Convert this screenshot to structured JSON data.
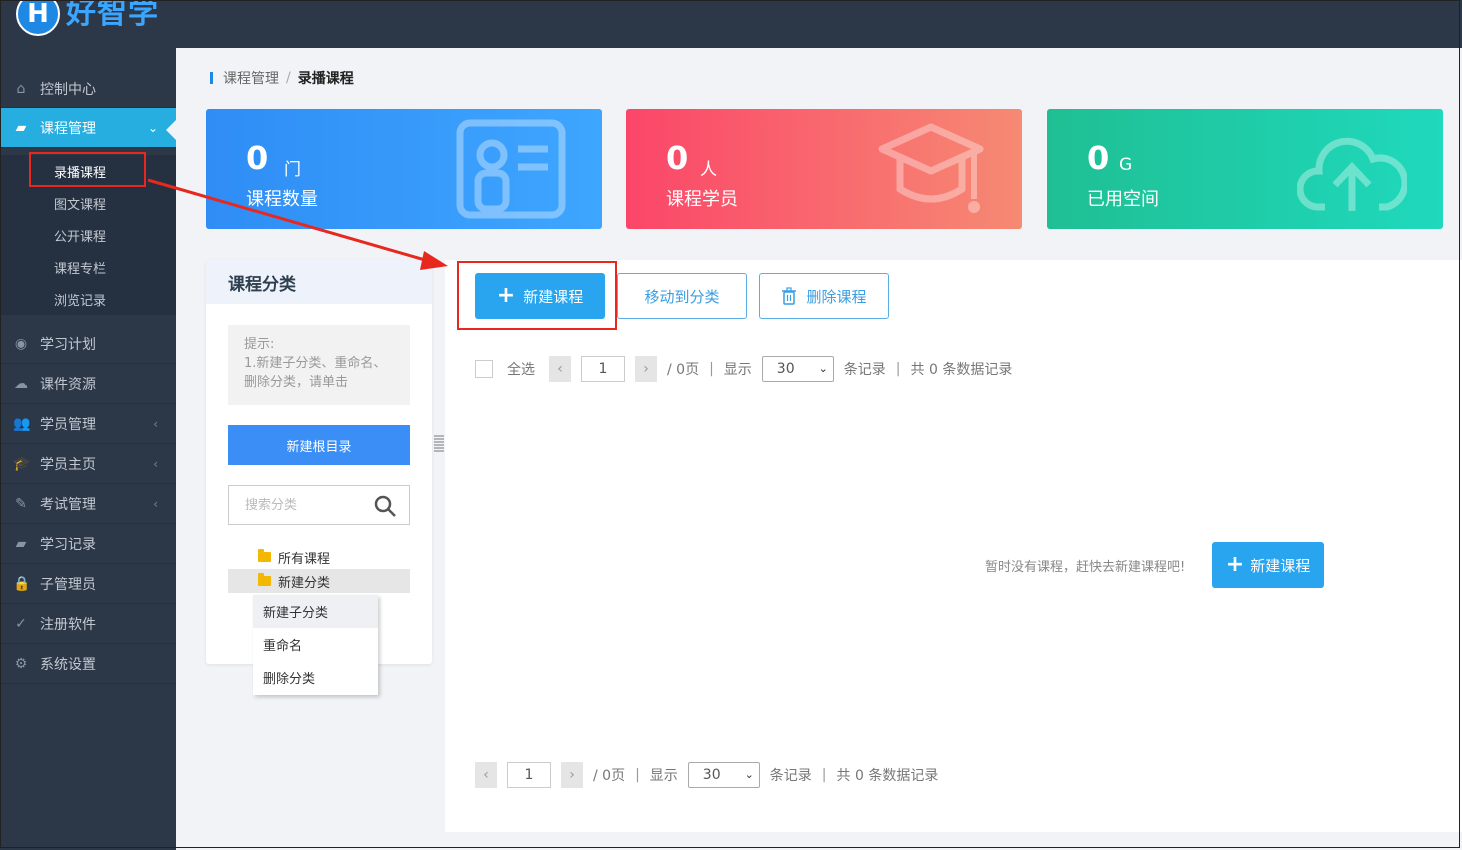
{
  "app": {
    "logo_letter": "H",
    "name": "好智学"
  },
  "sidebar": {
    "items": [
      {
        "label": "控制中心",
        "icon": "home-icon"
      },
      {
        "label": "课程管理",
        "icon": "book-icon",
        "active": true
      },
      {
        "label": "学习计划",
        "icon": "eye-icon"
      },
      {
        "label": "课件资源",
        "icon": "cloud-upload-icon"
      },
      {
        "label": "学员管理",
        "icon": "users-icon"
      },
      {
        "label": "学员主页",
        "icon": "graduation-cap-icon"
      },
      {
        "label": "考试管理",
        "icon": "pen-icon"
      },
      {
        "label": "学习记录",
        "icon": "book-icon"
      },
      {
        "label": "子管理员",
        "icon": "lock-icon"
      },
      {
        "label": "注册软件",
        "icon": "check-circle-icon"
      },
      {
        "label": "系统设置",
        "icon": "gear-icon"
      }
    ],
    "sub_items": [
      "录播课程",
      "图文课程",
      "公开课程",
      "课程专栏",
      "浏览记录"
    ]
  },
  "breadcrumb": {
    "parent": "课程管理",
    "sep": "/",
    "current": "录播课程"
  },
  "stats": [
    {
      "value": "0",
      "unit": "门",
      "label": "课程数量",
      "icon": "id-card-icon"
    },
    {
      "value": "0",
      "unit": "人",
      "label": "课程学员",
      "icon": "graduation-cap-icon"
    },
    {
      "value": "0",
      "unit": "G",
      "label": "已用空间",
      "icon": "cloud-upload-icon"
    }
  ],
  "category": {
    "title": "课程分类",
    "hint_title": "提示:",
    "hint_body": "1.新建子分类、重命名、删除分类，请单击",
    "new_root": "新建根目录",
    "search_placeholder": "搜索分类",
    "tree": [
      "所有课程",
      "新建分类"
    ],
    "context_menu": [
      "新建子分类",
      "重命名",
      "删除分类"
    ]
  },
  "toolbar": {
    "new_course": "新建课程",
    "move_to_category": "移动到分类",
    "delete_course": "删除课程"
  },
  "pager": {
    "select_all": "全选",
    "page": "1",
    "total_pages": "/ 0页",
    "show": "显示",
    "page_size": "30",
    "records": "条记录",
    "total": "共 0 条数据记录"
  },
  "empty": {
    "message": "暂时没有课程，赶快去新建课程吧!",
    "button": "新建课程"
  }
}
